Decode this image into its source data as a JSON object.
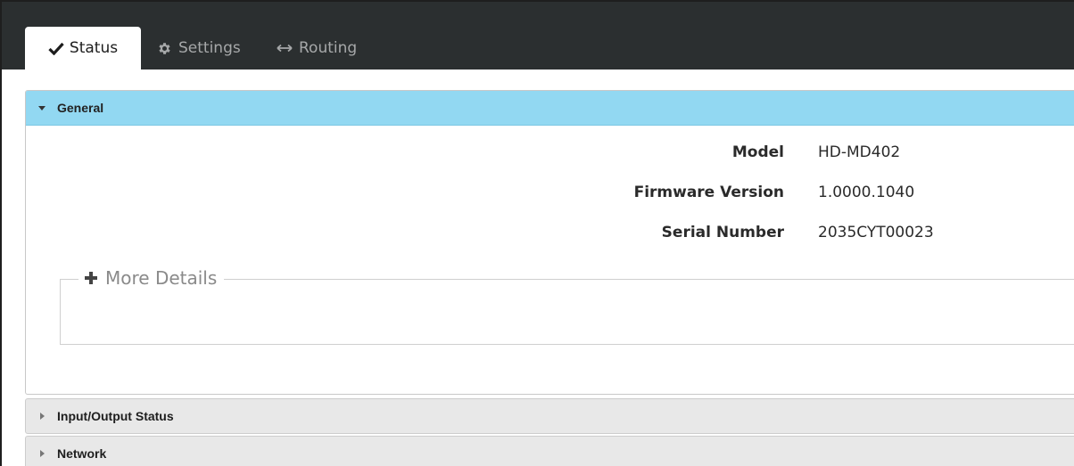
{
  "tabs": [
    {
      "label": "Status",
      "icon": "check-icon",
      "active": true
    },
    {
      "label": "Settings",
      "icon": "gear-icon",
      "active": false
    },
    {
      "label": "Routing",
      "icon": "arrows-horizontal-icon",
      "active": false
    }
  ],
  "general": {
    "title": "General",
    "rows": [
      {
        "label": "Model",
        "value": "HD-MD402"
      },
      {
        "label": "Firmware Version",
        "value": "1.0000.1040"
      },
      {
        "label": "Serial Number",
        "value": "2035CYT00023"
      }
    ],
    "more_details": "More Details"
  },
  "sections": [
    {
      "title": "Input/Output Status"
    },
    {
      "title": "Network"
    }
  ],
  "colors": {
    "topbar": "#2b2f30",
    "general_header": "#92d8f2",
    "collapsed_header": "#e8e8e8"
  }
}
